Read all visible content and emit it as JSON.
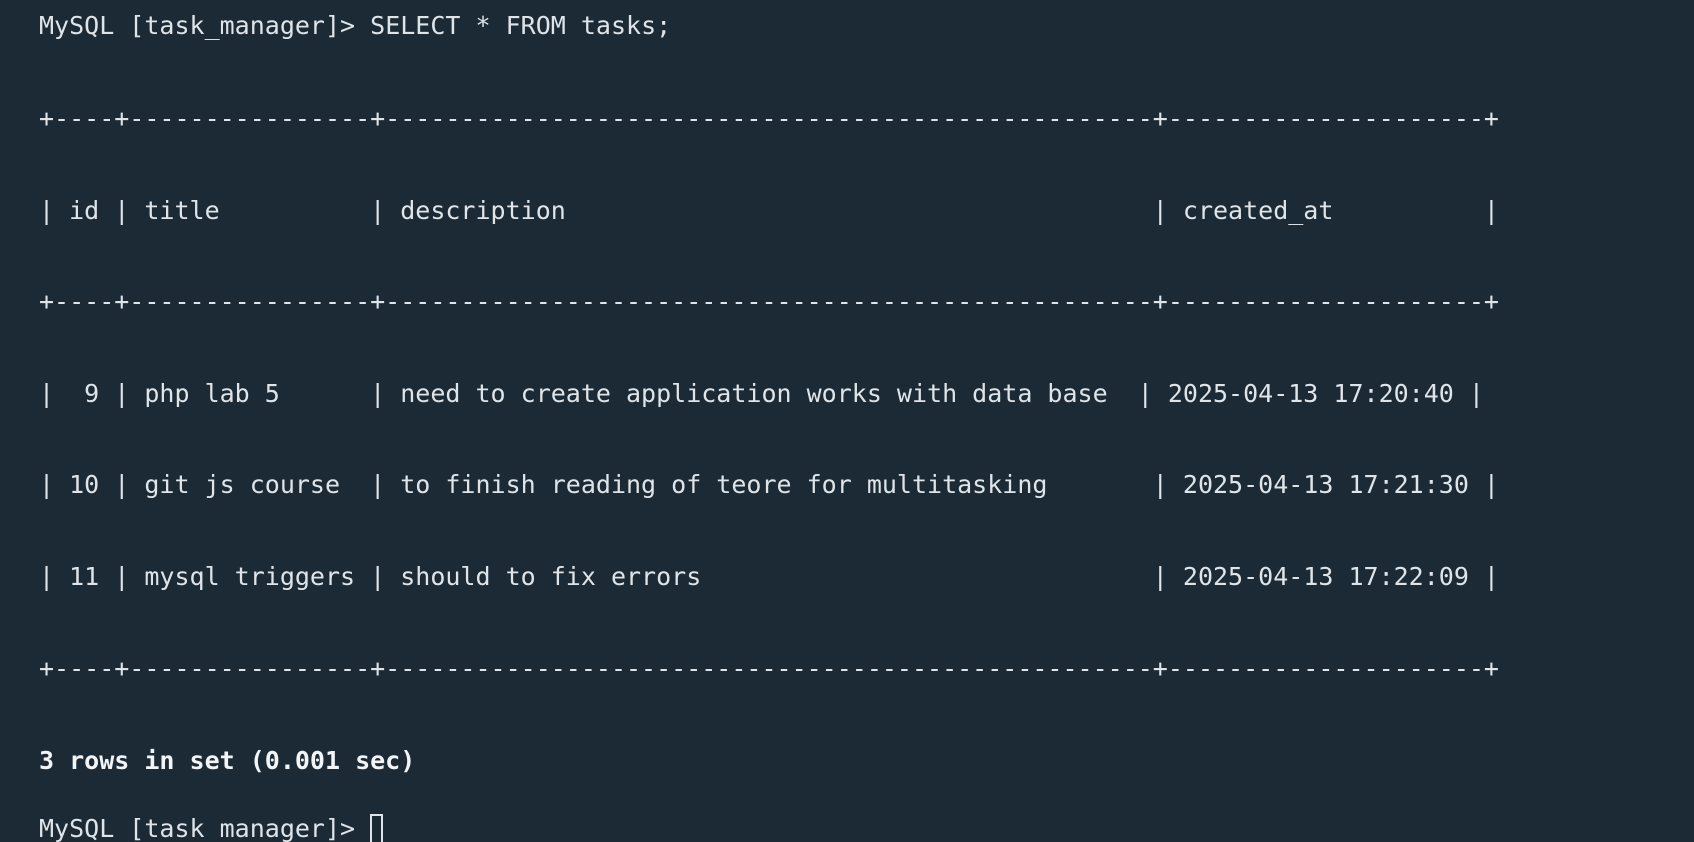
{
  "terminal": {
    "prompt": "MySQL [task_manager]> ",
    "command": "SELECT * FROM tasks;",
    "table": {
      "border": "+----+----------------+---------------------------------------------------+---------------------+",
      "header": "| id | title          | description                                       | created_at          |",
      "rows": [
        "|  9 | php lab 5      | need to create application works with data base  | 2025-04-13 17:20:40 |",
        "| 10 | git js course  | to finish reading of teore for multitasking       | 2025-04-13 17:21:30 |",
        "| 11 | mysql triggers | should to fix errors                              | 2025-04-13 17:22:09 |"
      ],
      "columns": [
        "id",
        "title",
        "description",
        "created_at"
      ],
      "data": [
        [
          "9",
          "php lab 5",
          "need to create application works with data base",
          "2025-04-13 17:20:40"
        ],
        [
          "10",
          "git js course",
          "to finish reading of teore for multitasking",
          "2025-04-13 17:21:30"
        ],
        [
          "11",
          "mysql triggers",
          "should to fix errors",
          "2025-04-13 17:22:09"
        ]
      ]
    },
    "summary": "3 rows in set (0.001 sec)",
    "next_prompt": "MySQL [task_manager]> "
  },
  "colors": {
    "background": "#1b2a35",
    "text": "#dfe4e8"
  }
}
